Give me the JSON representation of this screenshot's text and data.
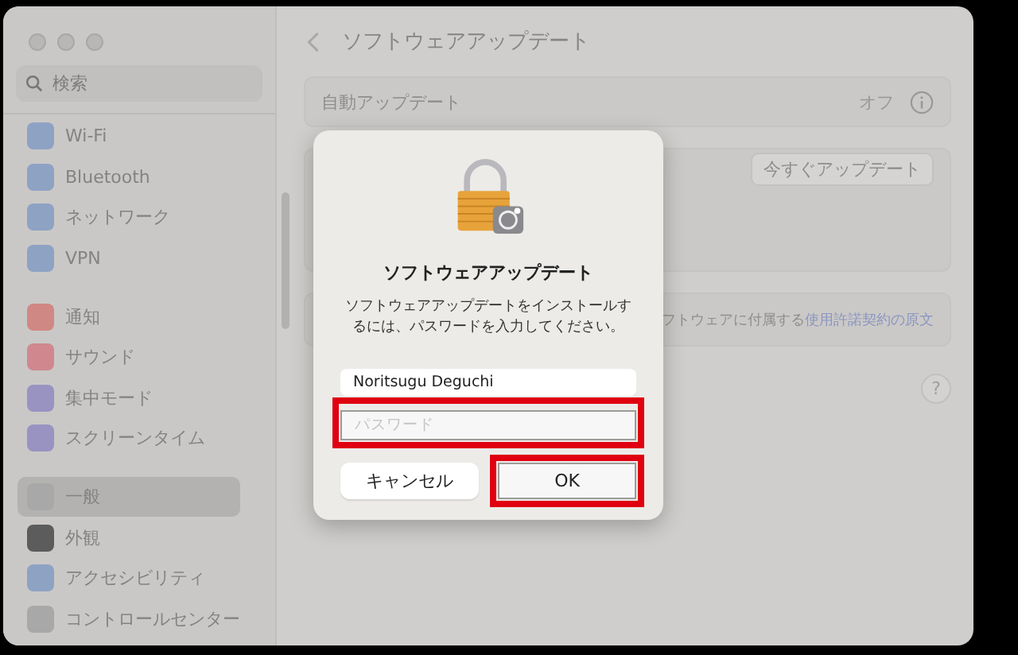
{
  "sidebar": {
    "search": {
      "placeholder": "検索"
    },
    "groups": [
      [
        {
          "label": "Wi-Fi",
          "color": "#8ea2c4",
          "selected": false
        },
        {
          "label": "Bluetooth",
          "color": "#8ea2c4",
          "selected": false
        },
        {
          "label": "ネットワーク",
          "color": "#8ea2c4",
          "selected": false
        },
        {
          "label": "VPN",
          "color": "#8ea2c4",
          "selected": false
        }
      ],
      [
        {
          "label": "通知",
          "color": "#d08884",
          "selected": false
        },
        {
          "label": "サウンド",
          "color": "#d0888e",
          "selected": false
        },
        {
          "label": "集中モード",
          "color": "#9993c2",
          "selected": false
        },
        {
          "label": "スクリーンタイム",
          "color": "#9993c2",
          "selected": false
        }
      ],
      [
        {
          "label": "一般",
          "color": "#a8a8a8",
          "selected": true
        },
        {
          "label": "外観",
          "color": "#5c5c5c",
          "selected": false
        },
        {
          "label": "アクセシビリティ",
          "color": "#8ea2c4",
          "selected": false
        },
        {
          "label": "コントロールセンター",
          "color": "#a8a8a8",
          "selected": false
        }
      ]
    ]
  },
  "header": {
    "title": "ソフトウェアアップデート"
  },
  "auto_update": {
    "label": "自動アップデート",
    "value": "オフ"
  },
  "update_now_button": "今すぐアップデート",
  "license_note": {
    "text": "フトウェアに付属する",
    "link": "使用許諾契約の原文"
  },
  "help_button": "?",
  "dialog": {
    "title": "ソフトウェアアップデート",
    "message": "ソフトウェアアップデートをインストールするには、パスワードを入力してください。",
    "fields": [
      {
        "value": "Noritsugu Deguchi",
        "highlighted": false
      },
      {
        "placeholder": "パスワード",
        "highlighted": true
      }
    ],
    "buttons": [
      {
        "label": "キャンセル",
        "highlighted": false
      },
      {
        "label": "OK",
        "highlighted": true
      }
    ]
  }
}
